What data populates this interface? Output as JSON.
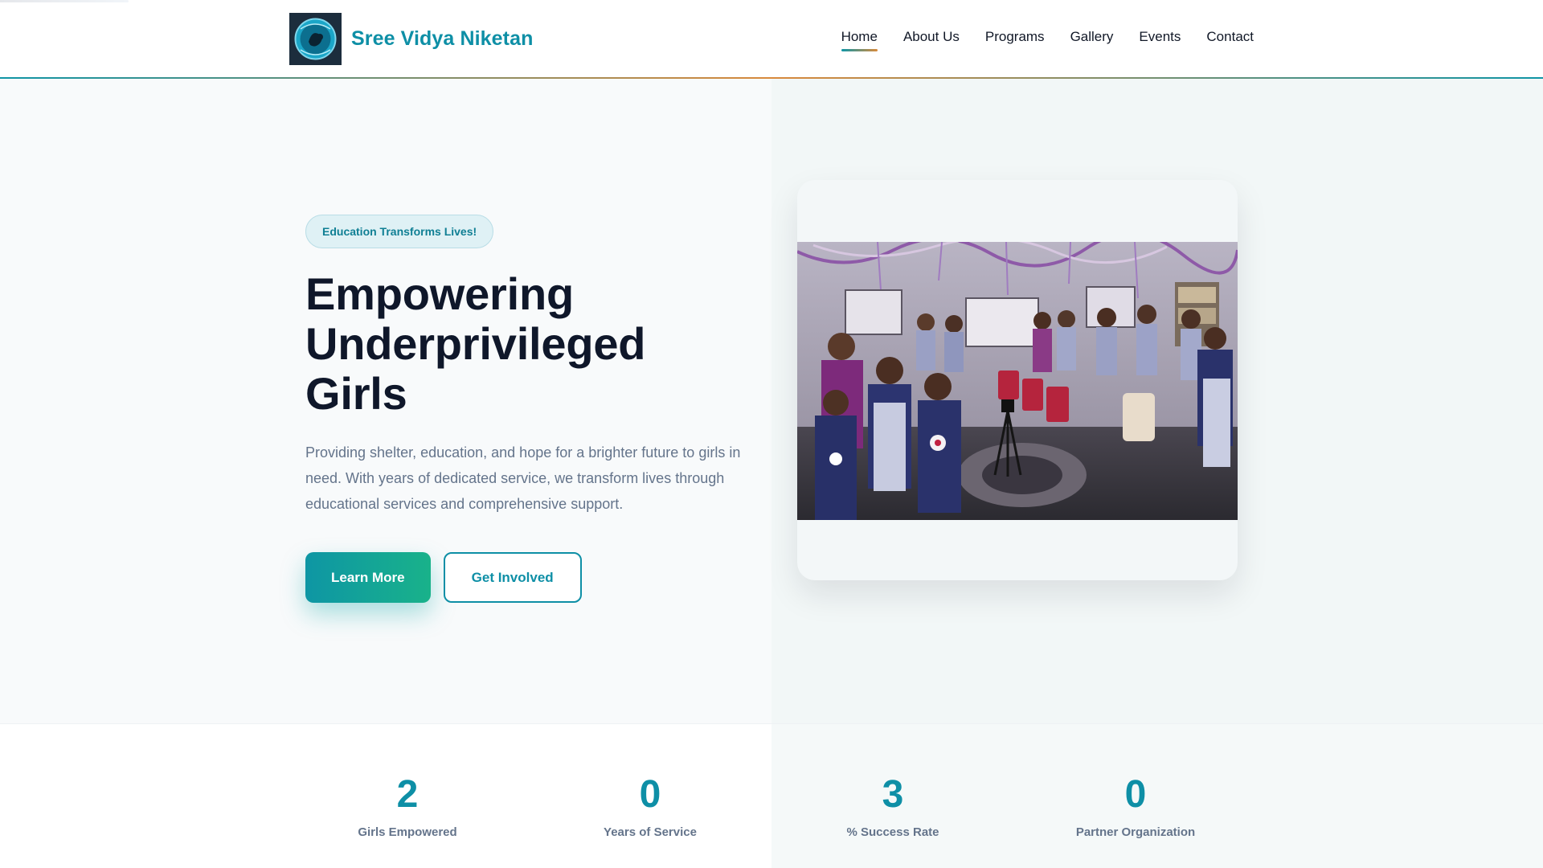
{
  "brand": {
    "name": "Sree Vidya Niketan",
    "logo_icon": "organization-logo-icon"
  },
  "nav": {
    "items": [
      {
        "label": "Home",
        "active": true
      },
      {
        "label": "About Us"
      },
      {
        "label": "Programs"
      },
      {
        "label": "Gallery"
      },
      {
        "label": "Events"
      },
      {
        "label": "Contact"
      }
    ]
  },
  "hero": {
    "badge": "Education Transforms Lives!",
    "title_line1": "Empowering",
    "title_line2": "Underprivileged Girls",
    "description": "Providing shelter, education, and hope for a brighter future to girls in need. With years of dedicated service, we transform lives through educational services and comprehensive support.",
    "primary_button": "Learn More",
    "secondary_button": "Get Involved",
    "image_icon": "students-photo"
  },
  "stats": [
    {
      "value": "2",
      "label": "Girls Empowered"
    },
    {
      "value": "0",
      "label": "Years of Service"
    },
    {
      "value": "3",
      "label": "% Success Rate"
    },
    {
      "value": "0",
      "label": "Partner Organization"
    }
  ],
  "colors": {
    "brand_teal": "#0e8fa6",
    "accent_orange": "#d98a3c",
    "button_gradient_start": "#0e96a4",
    "button_gradient_end": "#19b28a",
    "heading": "#0f172a",
    "muted_text": "#64748b"
  }
}
